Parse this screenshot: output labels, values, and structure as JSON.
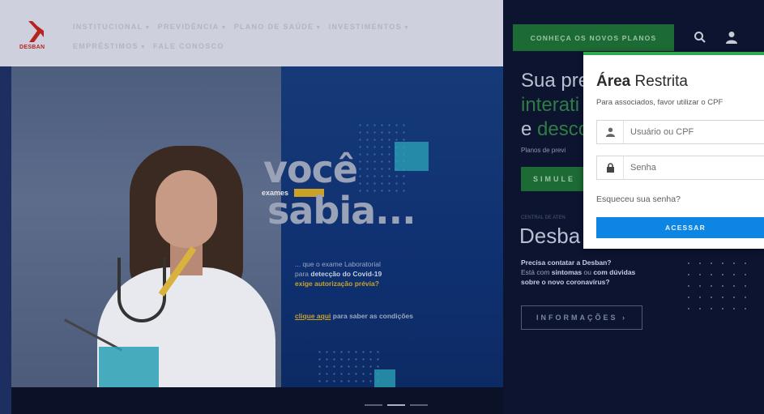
{
  "logo": {
    "text": "DESBAN"
  },
  "nav": {
    "row1": [
      {
        "label": "INSTITUCIONAL",
        "dropdown": true
      },
      {
        "label": "PREVIDÊNCIA",
        "dropdown": true
      },
      {
        "label": "PLANO DE SAÚDE",
        "dropdown": true
      },
      {
        "label": "INVESTIMENTOS",
        "dropdown": true
      }
    ],
    "row2": [
      {
        "label": "EMPRÉSTIMOS",
        "dropdown": true
      },
      {
        "label": "FALE CONOSCO",
        "dropdown": false
      }
    ],
    "cta_label": "CONHEÇA OS NOVOS PLANOS",
    "search_icon": "search-icon",
    "user_icon": "user-icon"
  },
  "hero": {
    "headline_1": "você",
    "exames": "exames",
    "headline_2": "sabia...",
    "para_1": "... que o exame Laboratorial",
    "para_2_prefix": "para ",
    "para_2_bold": "detecção do Covid-19",
    "para_3": "exige autorização prévia?",
    "link_label": "clique aqui",
    "link_suffix": " para saber as condições"
  },
  "right": {
    "headline_1": "Sua pre",
    "headline_2": "interati",
    "headline_3_prefix": "e ",
    "headline_3_green": "desco",
    "sub": "Planos de previ",
    "simule_label": "SIMULE",
    "central_label": "CENTRAL DE ATEN",
    "desban_title": "Desba",
    "help_1": "Precisa contatar a Desban?",
    "help_2_a": "Está com ",
    "help_2_b": "sintomas",
    "help_2_c": " ou ",
    "help_2_d": "com dúvidas",
    "help_3": "sobre o novo coronavírus?",
    "info_label": "INFORMAÇÕES ›"
  },
  "login": {
    "title_bold": "Área",
    "title_rest": " Restrita",
    "description": "Para associados, favor utilizar o CPF",
    "user_placeholder": "Usuário ou CPF",
    "password_placeholder": "Senha",
    "forgot_label": "Esqueceu sua senha?",
    "submit_label": "ACESSAR",
    "accent_color": "#2fa84f",
    "button_color": "#0d86e3"
  },
  "colors": {
    "brand_green": "#1c6a34",
    "highlight_yellow": "#c9a227",
    "navy": "#0c1430"
  }
}
